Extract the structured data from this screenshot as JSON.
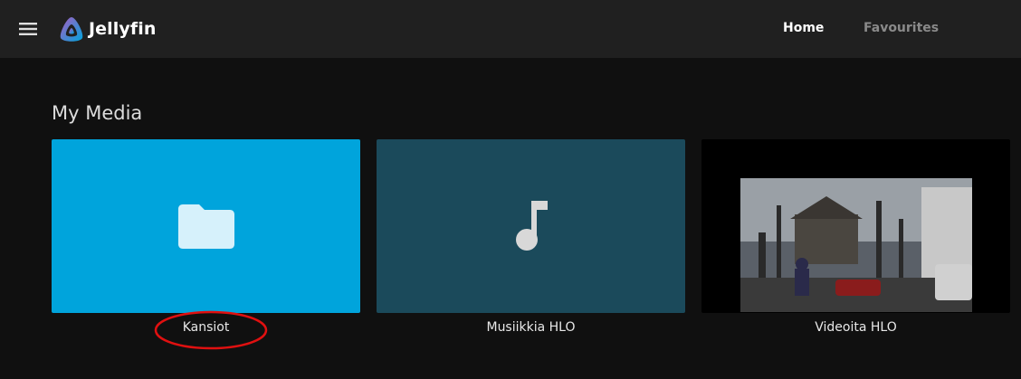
{
  "header": {
    "menu_icon": "hamburger-menu-icon",
    "logo_icon": "jellyfin-logo-icon",
    "app_name": "Jellyfin",
    "tabs": [
      {
        "label": "Home",
        "active": true
      },
      {
        "label": "Favourites",
        "active": false
      }
    ]
  },
  "section": {
    "title": "My Media",
    "items": [
      {
        "label": "Kansiot",
        "icon": "folder-icon",
        "tile_color": "#00a4dc"
      },
      {
        "label": "Musiikkia HLO",
        "icon": "music-note-icon",
        "tile_color": "#1b4a5b"
      },
      {
        "label": "Videoita HLO",
        "icon": "video-thumbnail",
        "tile_color": "#000000"
      }
    ]
  },
  "colors": {
    "header_bg": "#202020",
    "page_bg": "#101010",
    "accent": "#00a4dc",
    "annotation": "#e01010"
  }
}
